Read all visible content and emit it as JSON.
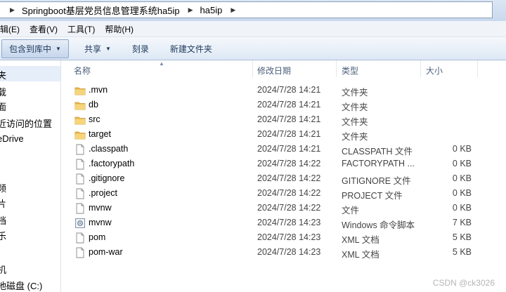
{
  "address": {
    "path": [
      "Springboot基层党员信息管理系统ha5ip",
      "ha5ip"
    ]
  },
  "menu": [
    "编辑(E)",
    "查看(V)",
    "工具(T)",
    "帮助(H)"
  ],
  "toolbar": {
    "include_library": "包含到库中",
    "share": "共享",
    "burn": "刻录",
    "new_folder": "新建文件夹"
  },
  "nav": {
    "items": [
      "夹",
      "载",
      "面",
      "近访问的位置",
      "eDrive",
      "",
      "",
      "频",
      "片",
      "档",
      "乐",
      "",
      "机",
      "地磁盘 (C:)"
    ]
  },
  "columns": {
    "name": "名称",
    "modified": "修改日期",
    "type": "类型",
    "size": "大小"
  },
  "files": [
    {
      "icon": "folder-icon",
      "name": ".mvn",
      "date": "2024/7/28 14:21",
      "type": "文件夹",
      "size": ""
    },
    {
      "icon": "folder-icon",
      "name": "db",
      "date": "2024/7/28 14:21",
      "type": "文件夹",
      "size": ""
    },
    {
      "icon": "folder-icon",
      "name": "src",
      "date": "2024/7/28 14:21",
      "type": "文件夹",
      "size": ""
    },
    {
      "icon": "folder-icon",
      "name": "target",
      "date": "2024/7/28 14:21",
      "type": "文件夹",
      "size": ""
    },
    {
      "icon": "file-icon",
      "name": ".classpath",
      "date": "2024/7/28 14:21",
      "type": "CLASSPATH 文件",
      "size": "0 KB"
    },
    {
      "icon": "file-icon",
      "name": ".factorypath",
      "date": "2024/7/28 14:22",
      "type": "FACTORYPATH ...",
      "size": "0 KB"
    },
    {
      "icon": "file-icon",
      "name": ".gitignore",
      "date": "2024/7/28 14:22",
      "type": "GITIGNORE 文件",
      "size": "0 KB"
    },
    {
      "icon": "file-icon",
      "name": ".project",
      "date": "2024/7/28 14:22",
      "type": "PROJECT 文件",
      "size": "0 KB"
    },
    {
      "icon": "file-icon",
      "name": "mvnw",
      "date": "2024/7/28 14:22",
      "type": "文件",
      "size": "0 KB"
    },
    {
      "icon": "script-icon",
      "name": "mvnw",
      "date": "2024/7/28 14:23",
      "type": "Windows 命令脚本",
      "size": "7 KB"
    },
    {
      "icon": "file-icon",
      "name": "pom",
      "date": "2024/7/28 14:23",
      "type": "XML 文档",
      "size": "5 KB"
    },
    {
      "icon": "file-icon",
      "name": "pom-war",
      "date": "2024/7/28 14:23",
      "type": "XML 文档",
      "size": "5 KB"
    }
  ],
  "watermark": "CSDN @ck3026"
}
